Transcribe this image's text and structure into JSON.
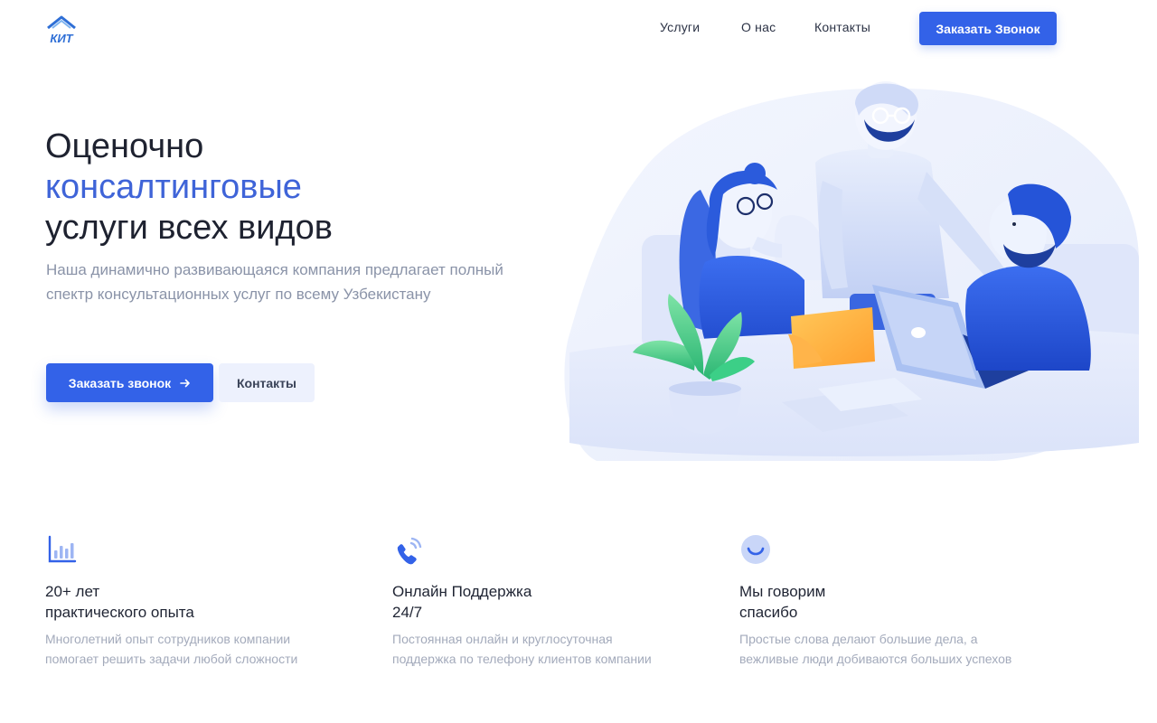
{
  "brand": {
    "logo_text": "КИТ"
  },
  "nav": {
    "links": [
      "Услуги",
      "О нас",
      "Контакты"
    ],
    "cta_label": "Заказать Звонок"
  },
  "hero": {
    "title_line1": "Оценочно",
    "title_accent": "консалтинговые",
    "title_line3": "услуги всех видов",
    "subtitle": "Наша динамично развивающаяся компания предлагает полный спектр консультационных услуг по всему Узбекистану",
    "primary_button": "Заказать звонок",
    "primary_button_icon": "arrow-right-icon",
    "secondary_button": "Контакты"
  },
  "features": [
    {
      "icon": "bar-chart-icon",
      "title_line1": "20+ лет",
      "title_line2": "практического опыта",
      "desc_line1": "Многолетний опыт сотрудников компании",
      "desc_line2": "помогает решить задачи любой сложности"
    },
    {
      "icon": "phone-icon",
      "title_line1": "Онлайн Поддержка",
      "title_line2": "24/7",
      "desc_line1": "Постоянная онлайн и круглосуточная",
      "desc_line2": "поддержка по телефону клиентов компании"
    },
    {
      "icon": "smile-icon",
      "title_line1": "Мы говорим",
      "title_line2": "спасибо",
      "desc_line1": "Простые слова делают большие дела, а",
      "desc_line2": "вежливые люди добиваются больших успехов"
    }
  ],
  "colors": {
    "accent": "#3362e8",
    "accent_text": "#3f64d8",
    "muted_text": "#8a93a8",
    "secondary_button_bg": "#edf1fd"
  }
}
